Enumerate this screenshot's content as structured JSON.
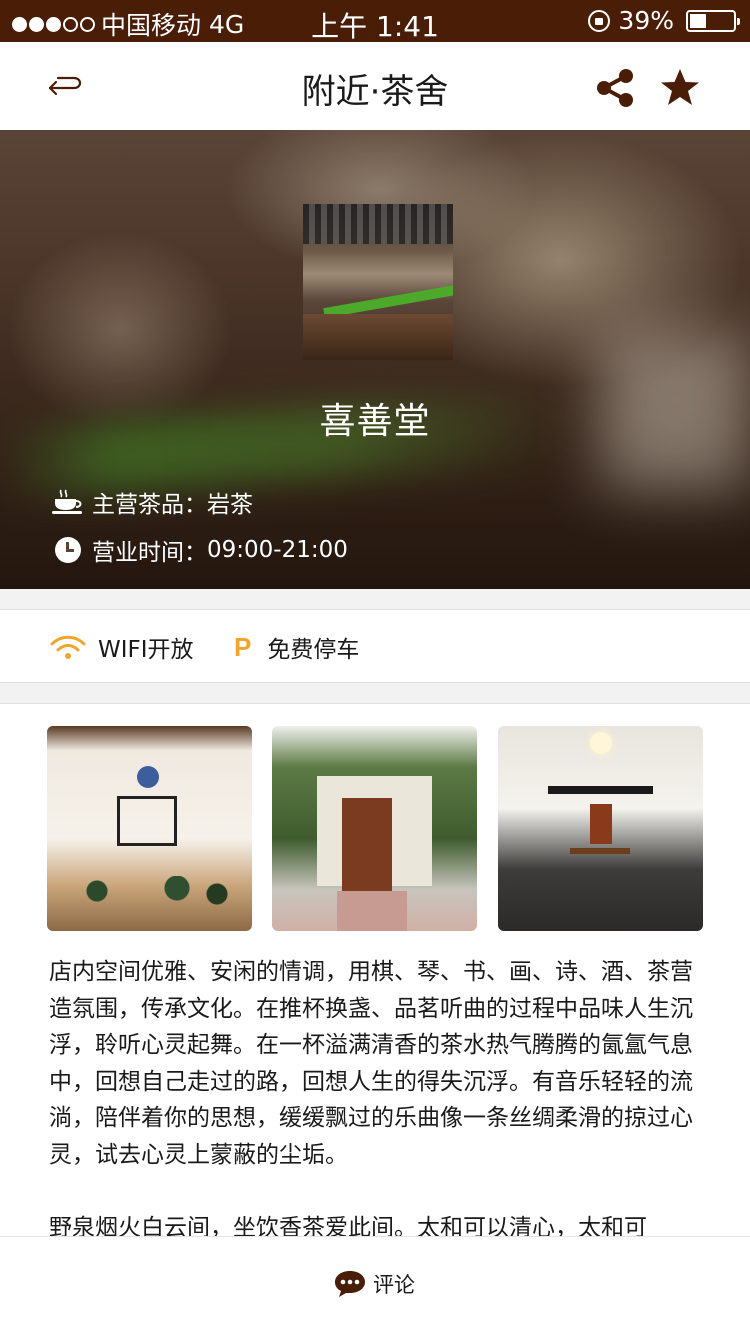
{
  "status_bar": {
    "carrier": "中国移动",
    "network": "4G",
    "time": "上午 1:41",
    "battery_percent_text": "39%",
    "battery_level": 0.39
  },
  "nav": {
    "title": "附近·茶舍",
    "back_icon": "back-arrow-icon",
    "share_icon": "share-icon",
    "favorite_icon": "star-icon"
  },
  "shop": {
    "name": "喜善堂",
    "tea_label": "主营茶品：",
    "tea_value": "岩茶",
    "hours_label": "营业时间：",
    "hours_value": "09:00-21:00"
  },
  "amenities": [
    {
      "icon": "wifi-icon",
      "label": "WIFI开放"
    },
    {
      "icon": "parking-icon",
      "label": "免费停车",
      "glyph": "P"
    }
  ],
  "description": [
    "店内空间优雅、安闲的情调，用棋、琴、书、画、诗、酒、茶营造氛围，传承文化。在推杯换盏、品茗听曲的过程中品味人生沉浮，聆听心灵起舞。在一杯溢满清香的茶水热气腾腾的氤氲气息中，回想自己走过的路，回想人生的得失沉浮。有音乐轻轻的流淌，陪伴着你的思想，缓缓飘过的乐曲像一条丝绸柔滑的掠过心灵，试去心灵上蒙蔽的尘垢。",
    "野泉烟火白云间，坐饮香茶爱此间。太和可以清心，太和可"
  ],
  "bottom_bar": {
    "comment_label": "评论",
    "comment_icon": "comment-icon"
  },
  "colors": {
    "status_bar_bg": "#4a1d07",
    "accent_brown": "#4a1d07",
    "amenity_yellow": "#f2a526"
  }
}
